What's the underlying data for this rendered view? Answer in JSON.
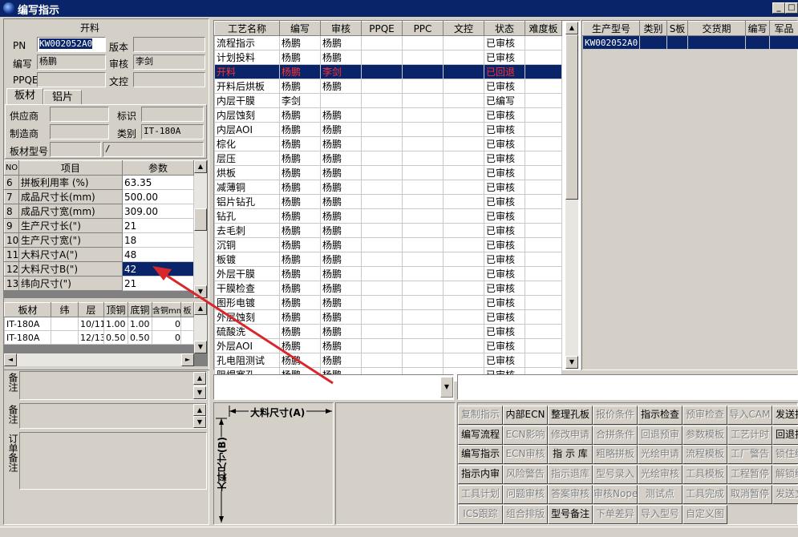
{
  "window": {
    "title": "编写指示",
    "min_label": "_"
  },
  "left_header": "开料",
  "fields": {
    "pn_label": "PN",
    "pn_value": "KW002052A0",
    "version_label": "版本",
    "version_value": "",
    "author_label": "编写",
    "author_value": "杨鹏",
    "reviewer_label": "审核",
    "reviewer_value": "李剑",
    "ppqe_label": "PPQE",
    "ppqe_value": "",
    "doc_label": "文控",
    "doc_value": ""
  },
  "tabs": [
    "板材",
    "铝片"
  ],
  "material": {
    "supplier_label": "供应商",
    "supplier_value": "",
    "mark_label": "标识",
    "mark_value": "",
    "maker_label": "制造商",
    "maker_value": "",
    "category_label": "类别",
    "category_value": "IT-180A",
    "model_label": "板材型号",
    "model_value": "",
    "model_value2": "/"
  },
  "param_table": {
    "headers": [
      "NO",
      "项目",
      "参数"
    ],
    "rows": [
      {
        "no": "6",
        "item": "拼板利用率 (%)",
        "value": "63.35"
      },
      {
        "no": "7",
        "item": "成品尺寸长(mm)",
        "value": "500.00"
      },
      {
        "no": "8",
        "item": "成品尺寸宽(mm)",
        "value": "309.00"
      },
      {
        "no": "9",
        "item": "生产尺寸长(\")",
        "value": "21"
      },
      {
        "no": "10",
        "item": "生产尺寸宽(\")",
        "value": "18"
      },
      {
        "no": "11",
        "item": "大料尺寸A(\")",
        "value": "48"
      },
      {
        "no": "12",
        "item": "大料尺寸B(\")",
        "value": "42"
      },
      {
        "no": "13",
        "item": "纬向尺寸(\")",
        "value": "21"
      }
    ]
  },
  "board_table": {
    "headers": [
      "板材",
      "纬",
      "层",
      "顶铜",
      "底铜",
      "含铜mm",
      "板"
    ],
    "rows": [
      {
        "board": "IT-180A",
        "weft": "",
        "layer": "10/11",
        "top": "1.00",
        "bottom": "1.00",
        "cu": "0"
      },
      {
        "board": "IT-180A",
        "weft": "",
        "layer": "12/13",
        "top": "0.50",
        "bottom": "0.50",
        "cu": "0"
      }
    ]
  },
  "notes": {
    "process": "工艺备注",
    "model": "型号备注",
    "order": "订单备注"
  },
  "process_table": {
    "headers": [
      "工艺名称",
      "编写",
      "审核",
      "PPQE",
      "PPC",
      "文控",
      "状态",
      "难度板"
    ],
    "rows": [
      {
        "name": "流程指示",
        "author": "杨鹏",
        "reviewer": "杨鹏",
        "status": "已审核"
      },
      {
        "name": "计划投料",
        "author": "杨鹏",
        "reviewer": "杨鹏",
        "status": "已审核"
      },
      {
        "name": "开料",
        "author": "杨鹏",
        "reviewer": "李剑",
        "status": "已回退"
      },
      {
        "name": "开料后烘板",
        "author": "杨鹏",
        "reviewer": "杨鹏",
        "status": "已审核"
      },
      {
        "name": "内层干膜",
        "author": "李剑",
        "reviewer": "",
        "status": "已编写"
      },
      {
        "name": "内层蚀刻",
        "author": "杨鹏",
        "reviewer": "杨鹏",
        "status": "已审核"
      },
      {
        "name": "内层AOI",
        "author": "杨鹏",
        "reviewer": "杨鹏",
        "status": "已审核"
      },
      {
        "name": "棕化",
        "author": "杨鹏",
        "reviewer": "杨鹏",
        "status": "已审核"
      },
      {
        "name": "层压",
        "author": "杨鹏",
        "reviewer": "杨鹏",
        "status": "已审核"
      },
      {
        "name": "烘板",
        "author": "杨鹏",
        "reviewer": "杨鹏",
        "status": "已审核"
      },
      {
        "name": "减薄铜",
        "author": "杨鹏",
        "reviewer": "杨鹏",
        "status": "已审核"
      },
      {
        "name": "铝片钻孔",
        "author": "杨鹏",
        "reviewer": "杨鹏",
        "status": "已审核"
      },
      {
        "name": "钻孔",
        "author": "杨鹏",
        "reviewer": "杨鹏",
        "status": "已审核"
      },
      {
        "name": "去毛刺",
        "author": "杨鹏",
        "reviewer": "杨鹏",
        "status": "已审核"
      },
      {
        "name": "沉铜",
        "author": "杨鹏",
        "reviewer": "杨鹏",
        "status": "已审核"
      },
      {
        "name": "板镀",
        "author": "杨鹏",
        "reviewer": "杨鹏",
        "status": "已审核"
      },
      {
        "name": "外层干膜",
        "author": "杨鹏",
        "reviewer": "杨鹏",
        "status": "已审核"
      },
      {
        "name": "干膜检查",
        "author": "杨鹏",
        "reviewer": "杨鹏",
        "status": "已审核"
      },
      {
        "name": "图形电镀",
        "author": "杨鹏",
        "reviewer": "杨鹏",
        "status": "已审核"
      },
      {
        "name": "外层蚀刻",
        "author": "杨鹏",
        "reviewer": "杨鹏",
        "status": "已审核"
      },
      {
        "name": "硫酸洗",
        "author": "杨鹏",
        "reviewer": "杨鹏",
        "status": "已审核"
      },
      {
        "name": "外层AOI",
        "author": "杨鹏",
        "reviewer": "杨鹏",
        "status": "已审核"
      },
      {
        "name": "孔电阻测试",
        "author": "杨鹏",
        "reviewer": "杨鹏",
        "status": "已审核"
      },
      {
        "name": "阻焊塞孔",
        "author": "杨鹏",
        "reviewer": "杨鹏",
        "status": "已审核"
      }
    ]
  },
  "product_table": {
    "headers": [
      "生产型号",
      "类别",
      "S板",
      "交货期",
      "编写",
      "军品"
    ],
    "rows": [
      {
        "model": "KW002052A0"
      }
    ]
  },
  "diagram": {
    "label_a": "大料尺寸(A)",
    "label_b": "大料尺寸(B)"
  },
  "buttons": [
    [
      {
        "label": "复制指示",
        "enabled": false
      },
      {
        "label": "内部ECN",
        "enabled": true
      },
      {
        "label": "整理孔板",
        "enabled": true
      },
      {
        "label": "报价条件",
        "enabled": false
      },
      {
        "label": "指示检查",
        "enabled": true
      },
      {
        "label": "预审检查",
        "enabled": false
      },
      {
        "label": "导入CAM",
        "enabled": false
      },
      {
        "label": "发送指示",
        "enabled": true
      }
    ],
    [
      {
        "label": "编写流程",
        "enabled": true
      },
      {
        "label": "ECN影响",
        "enabled": false
      },
      {
        "label": "修改申请",
        "enabled": false
      },
      {
        "label": "合拼条件",
        "enabled": false
      },
      {
        "label": "回退预审",
        "enabled": false
      },
      {
        "label": "参数模板",
        "enabled": false
      },
      {
        "label": "工艺计时",
        "enabled": false
      },
      {
        "label": "回退指示",
        "enabled": true
      }
    ],
    [
      {
        "label": "编写指示",
        "enabled": true
      },
      {
        "label": "ECN审核",
        "enabled": false
      },
      {
        "label": "指 示 库",
        "enabled": true
      },
      {
        "label": "粗略拼板",
        "enabled": false
      },
      {
        "label": "光绘申请",
        "enabled": false
      },
      {
        "label": "流程模板",
        "enabled": false
      },
      {
        "label": "工厂警告",
        "enabled": false
      },
      {
        "label": "锁住编辑",
        "enabled": false
      }
    ],
    [
      {
        "label": "指示内审",
        "enabled": true
      },
      {
        "label": "风险警告",
        "enabled": false
      },
      {
        "label": "指示退库",
        "enabled": false
      },
      {
        "label": "型号录入",
        "enabled": false
      },
      {
        "label": "光绘审核",
        "enabled": false
      },
      {
        "label": "工具模板",
        "enabled": false
      },
      {
        "label": "工程暂停",
        "enabled": false
      },
      {
        "label": "解锁编辑",
        "enabled": false
      }
    ],
    [
      {
        "label": "工具计划",
        "enabled": false
      },
      {
        "label": "问题审核",
        "enabled": false
      },
      {
        "label": "答案审核",
        "enabled": false
      },
      {
        "label": "审核Nope",
        "enabled": false
      },
      {
        "label": "测试点",
        "enabled": false
      },
      {
        "label": "工具完成",
        "enabled": false
      },
      {
        "label": "取消暂停",
        "enabled": false
      },
      {
        "label": "发送文档",
        "enabled": false
      }
    ],
    [
      {
        "label": "ICS跟踪",
        "enabled": false
      },
      {
        "label": "组合排版",
        "enabled": false
      },
      {
        "label": "型号备注",
        "enabled": true
      },
      {
        "label": "下单差异",
        "enabled": false
      },
      {
        "label": "导入型号",
        "enabled": false
      },
      {
        "label": "自定义图",
        "enabled": false
      }
    ]
  ],
  "colors": {
    "selection": "#0a246a",
    "reject_text": "#ff3030",
    "arrow": "#d9262b"
  }
}
